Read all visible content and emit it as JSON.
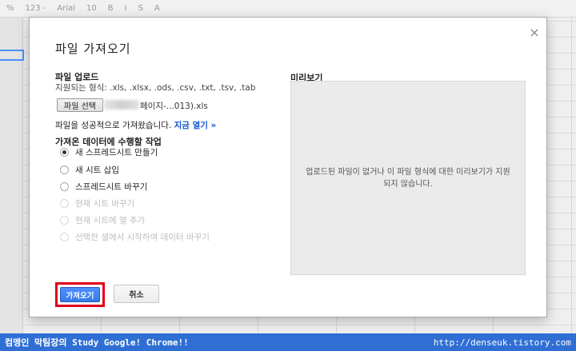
{
  "toolbar": {
    "items": [
      "%",
      "123 -",
      "Arial",
      "10",
      "B",
      "I",
      "S",
      "A"
    ]
  },
  "dialog": {
    "title": "파일 가져오기",
    "upload": {
      "heading": "파일 업로드",
      "supported_formats": "지원되는 형식: .xls, .xlsx, .ods, .csv, .txt, .tsv, .tab",
      "file_button": "파일 선택",
      "file_name": "페이지-...013).xls",
      "success_text": "파일을 성공적으로 가져왔습니다.",
      "open_link": "지금 열기 »"
    },
    "action": {
      "heading": "가져온 데이터에 수행할 작업",
      "options": [
        {
          "label": "새 스프레드시트 만들기",
          "checked": true,
          "disabled": false
        },
        {
          "label": "새 시트 삽입",
          "checked": false,
          "disabled": false
        },
        {
          "label": "스프레드시트 바꾸기",
          "checked": false,
          "disabled": false
        },
        {
          "label": "현재 시트 바꾸기",
          "checked": false,
          "disabled": true
        },
        {
          "label": "현재 시트에 열 추가",
          "checked": false,
          "disabled": true
        },
        {
          "label": "선택한 셀에서 시작하여 데이터 바꾸기",
          "checked": false,
          "disabled": true
        }
      ]
    },
    "preview": {
      "heading": "미리보기",
      "message": "업로드된 파일이 없거나 이 파일 형식에 대한 미리보기가 지원되지 않습니다."
    },
    "buttons": {
      "import": "가져오기",
      "cancel": "취소"
    }
  },
  "footer": {
    "left": "컴맹인 막팀장의 Study Google! Chrome!!",
    "right": "http://denseuk.tistory.com"
  },
  "colors": {
    "accent": "#4d90fe",
    "highlight": "#e0001a",
    "link": "#1155cc",
    "footer": "#2f6fd4"
  }
}
